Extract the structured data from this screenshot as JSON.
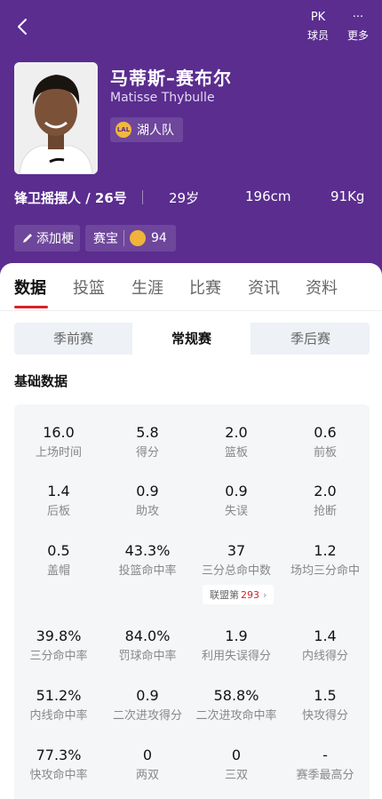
{
  "topbar": {
    "pk_icon_text": "PK",
    "more_icon_text": "···",
    "players_label": "球员",
    "more_label": "更多"
  },
  "player": {
    "name_cn": "马蒂斯–赛布尔",
    "name_en": "Matisse Thybulle",
    "team": "湖人队",
    "position_number": "锋卫摇摆人 / 26号",
    "age": "29岁",
    "height": "196cm",
    "weight": "91Kg"
  },
  "actions": {
    "add_meme": "添加梗",
    "treasure_label": "赛宝",
    "treasure_count": "94"
  },
  "tabs": [
    "数据",
    "投篮",
    "生涯",
    "比赛",
    "资讯",
    "资料"
  ],
  "segments": [
    "季前赛",
    "常规赛",
    "季后赛"
  ],
  "section_title": "基础数据",
  "stats": [
    {
      "value": "16.0",
      "label": "上场时间"
    },
    {
      "value": "5.8",
      "label": "得分"
    },
    {
      "value": "2.0",
      "label": "篮板"
    },
    {
      "value": "0.6",
      "label": "前板"
    },
    {
      "value": "1.4",
      "label": "后板"
    },
    {
      "value": "0.9",
      "label": "助攻"
    },
    {
      "value": "0.9",
      "label": "失误"
    },
    {
      "value": "2.0",
      "label": "抢断"
    },
    {
      "value": "0.5",
      "label": "盖帽"
    },
    {
      "value": "43.3%",
      "label": "投篮命中率"
    },
    {
      "value": "37",
      "label": "三分总命中数"
    },
    {
      "value": "1.2",
      "label": "场均三分命中"
    },
    {
      "value": "39.8%",
      "label": "三分命中率"
    },
    {
      "value": "84.0%",
      "label": "罚球命中率"
    },
    {
      "value": "1.9",
      "label": "利用失误得分"
    },
    {
      "value": "1.4",
      "label": "内线得分"
    },
    {
      "value": "51.2%",
      "label": "内线命中率"
    },
    {
      "value": "0.9",
      "label": "二次进攻得分"
    },
    {
      "value": "58.8%",
      "label": "二次进攻命中率"
    },
    {
      "value": "1.5",
      "label": "快攻得分"
    },
    {
      "value": "77.3%",
      "label": "快攻命中率"
    },
    {
      "value": "0",
      "label": "两双"
    },
    {
      "value": "0",
      "label": "三双"
    },
    {
      "value": "-",
      "label": "赛季最高分"
    }
  ],
  "league_rank": {
    "label": "联盟第",
    "value": "293",
    "arrow": "›"
  },
  "colors": {
    "header_bg": "#5a2d8f",
    "accent_red": "#d8222b",
    "stats_bg": "#f4f6f8"
  }
}
